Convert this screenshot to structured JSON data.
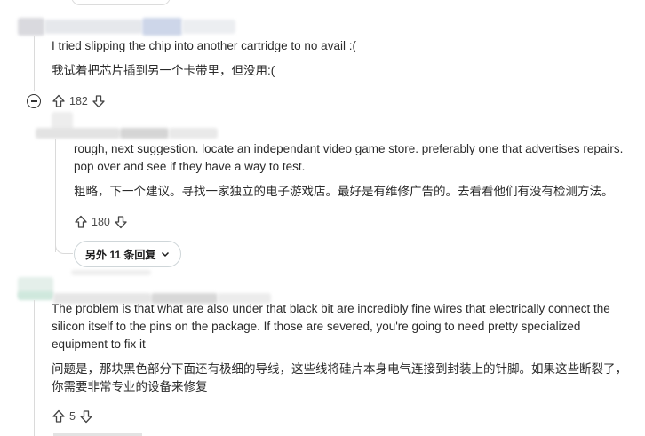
{
  "comments": [
    {
      "text": "I tried slipping the chip into another cartridge to no avail :(",
      "translation": "我试着把芯片插到另一个卡带里，但没用:(",
      "score": "182",
      "icons": [
        "upvote-icon",
        "downvote-icon",
        "collapse-icon"
      ]
    },
    {
      "text_line1": "rough, next suggestion. locate an independant video game store. preferably one that advertises repairs.",
      "text_line2": "pop over and see if they have a way to test.",
      "translation": "粗略，下一个建议。寻找一家独立的电子游戏店。最好是有维修广告的。去看看他们有没有检测方法。",
      "score": "180",
      "more_replies_label": "另外 11 条回复"
    },
    {
      "text": "The problem is that what are also under that black bit are incredibly fine wires that electrically connect the silicon itself to the pins on the package. If those are severed, you're going to need pretty specialized equipment to fix it",
      "translation": "问题是，那块黑色部分下面还有极细的导线，这些线将硅片本身电气连接到封装上的针脚。如果这些断裂了，你需要非常专业的设备来修复",
      "score": "5"
    }
  ],
  "colors": {
    "thread_line": "#dadada",
    "muted": "#576f76"
  }
}
